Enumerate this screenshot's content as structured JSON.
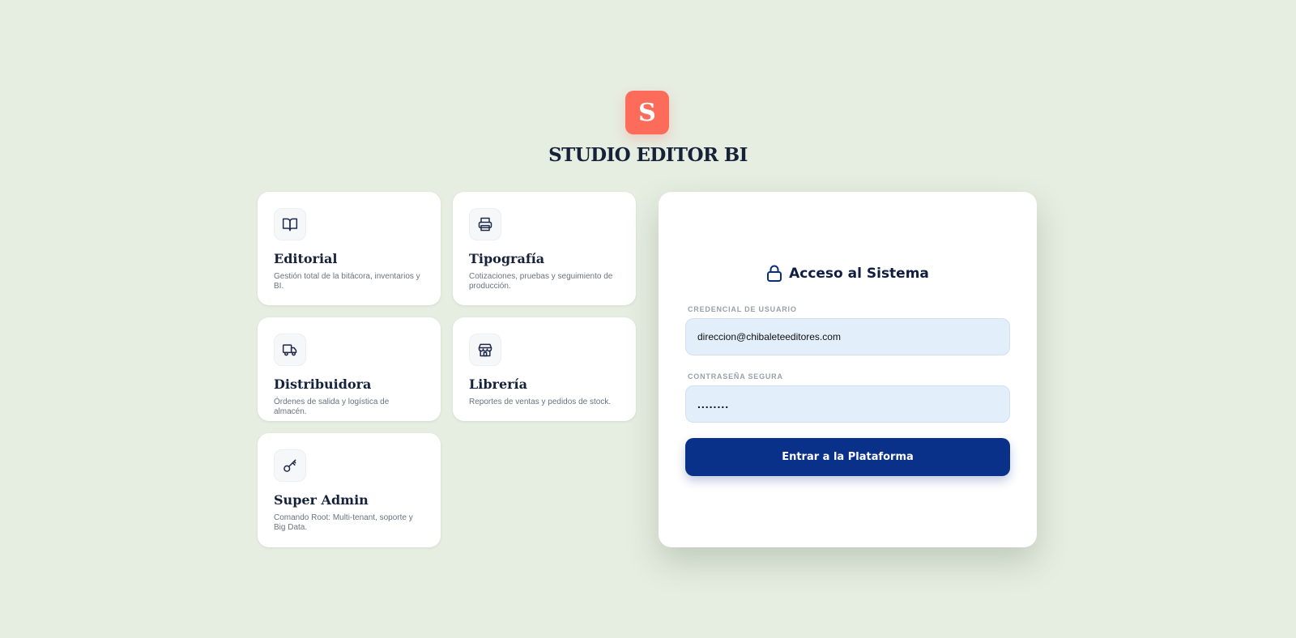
{
  "brand": {
    "logo_letter": "S",
    "title": "STUDIO EDITOR BI",
    "logo_color": "#fd6b5b"
  },
  "modules": [
    {
      "title": "Editorial",
      "description": "Gestión total de la bitácora, inventarios y BI.",
      "icon": "book-open-icon"
    },
    {
      "title": "Tipografía",
      "description": "Cotizaciones, pruebas y seguimiento de producción.",
      "icon": "printer-icon"
    },
    {
      "title": "Distribuidora",
      "description": "Órdenes de salida y logística de almacén.",
      "icon": "truck-icon"
    },
    {
      "title": "Librería",
      "description": "Reportes de ventas y pedidos de stock.",
      "icon": "store-icon"
    },
    {
      "title": "Super Admin",
      "description": "Comando Root: Multi-tenant, soporte y Big Data.",
      "icon": "key-icon"
    }
  ],
  "login": {
    "heading": "Acceso al Sistema",
    "heading_icon": "lock-icon",
    "user_label": "CREDENCIAL DE USUARIO",
    "user_value": "direccion@chibaleteeditores.com",
    "password_label": "CONTRASEÑA SEGURA",
    "password_value": "........",
    "submit_label": "Entrar a la Plataforma",
    "accent_color": "#0a318a"
  }
}
